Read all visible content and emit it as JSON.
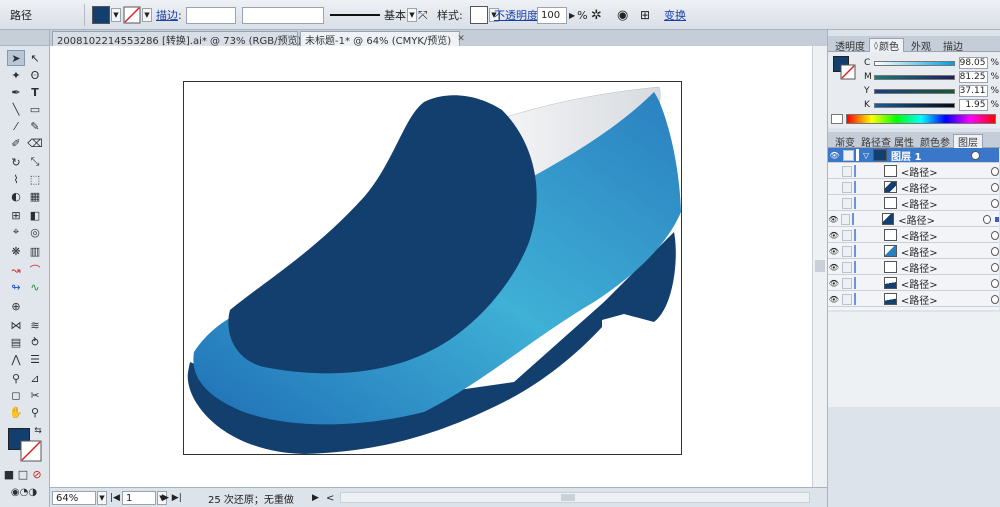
{
  "control_bar": {
    "object_type": "路径",
    "stroke_label": "描边",
    "stroke_weight": "",
    "variable_width": "",
    "brush_profile": "基本",
    "style_label": "样式",
    "opacity_label": "不透明度",
    "opacity_value": "100",
    "opacity_unit": "%",
    "transform_label": "变换"
  },
  "documents": [
    {
      "title": "2008102214553286 [转换].ai* @ 73% (RGB/预览)",
      "active": false
    },
    {
      "title": "未标题-1* @ 64% (CMYK/预览)",
      "active": true
    }
  ],
  "status_bar": {
    "zoom": "64%",
    "artboard": "1",
    "history": "25 次还原；无重做"
  },
  "color_panel": {
    "tabs": [
      "透明度",
      "颜色",
      "外观",
      "描边"
    ],
    "active_tab": "颜色",
    "channels": [
      {
        "label": "C",
        "value": "98.05",
        "unit": "%"
      },
      {
        "label": "M",
        "value": "81.25",
        "unit": "%"
      },
      {
        "label": "Y",
        "value": "37.11",
        "unit": "%"
      },
      {
        "label": "K",
        "value": "1.95",
        "unit": "%"
      }
    ],
    "fill_color": "#123f6e"
  },
  "layers_panel": {
    "tabs": [
      "渐变",
      "路径查",
      "属性",
      "颜色参",
      "图层"
    ],
    "active_tab": "图层",
    "layer_name": "图层 1",
    "items": [
      {
        "name": "<路径>"
      },
      {
        "name": "<路径>"
      },
      {
        "name": "<路径>"
      },
      {
        "name": "<路径>"
      },
      {
        "name": "<路径>"
      },
      {
        "name": "<路径>"
      },
      {
        "name": "<路径>"
      },
      {
        "name": "<路径>"
      },
      {
        "name": "<路径>"
      }
    ]
  },
  "colors": {
    "shoe_dark": "#123f6e",
    "shoe_light": "#3fb0d6",
    "shoe_mid": "#2a7fbf",
    "accent_blue": "#3a77c9"
  }
}
